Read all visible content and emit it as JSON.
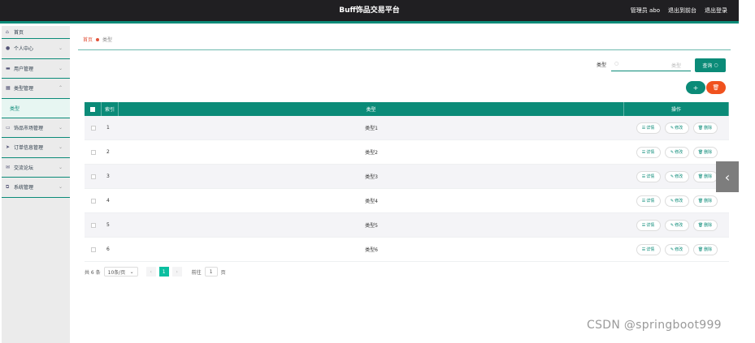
{
  "header": {
    "title": "Buff饰品交易平台",
    "admin_label": "管理员 abo",
    "back_link": "退出到前台",
    "logout_link": "退出登录"
  },
  "sidebar": {
    "home": "首页",
    "items": [
      {
        "label": "个人中心"
      },
      {
        "label": "用户管理"
      },
      {
        "label": "类型管理"
      },
      {
        "label": "饰品市场管理"
      },
      {
        "label": "订单信息管理"
      },
      {
        "label": "交流论坛"
      },
      {
        "label": "系统管理"
      }
    ],
    "sub_item": "类型"
  },
  "breadcrumb": {
    "home": "首页",
    "current": "类型"
  },
  "search": {
    "label": "类型",
    "placeholder": "类型",
    "button": "查询"
  },
  "actions": {
    "add": "+",
    "delete": "🗑"
  },
  "table": {
    "headers": {
      "index": "索引",
      "type": "类型",
      "ops": "操作"
    },
    "rows": [
      {
        "index": "1",
        "type": "类型1"
      },
      {
        "index": "2",
        "type": "类型2"
      },
      {
        "index": "3",
        "type": "类型3"
      },
      {
        "index": "4",
        "type": "类型4"
      },
      {
        "index": "5",
        "type": "类型5"
      },
      {
        "index": "6",
        "type": "类型6"
      }
    ],
    "op_detail": "详情",
    "op_edit": "修改",
    "op_delete": "删除"
  },
  "pagination": {
    "total": "共 6 条",
    "page_size": "10条/页",
    "current": "1",
    "goto_label": "前往",
    "goto_value": "1",
    "page_suffix": "页"
  },
  "watermark": "CSDN @springboot999",
  "colors": {
    "accent": "#0b8b78",
    "danger": "#f0521e",
    "header_bg": "#201f22"
  }
}
